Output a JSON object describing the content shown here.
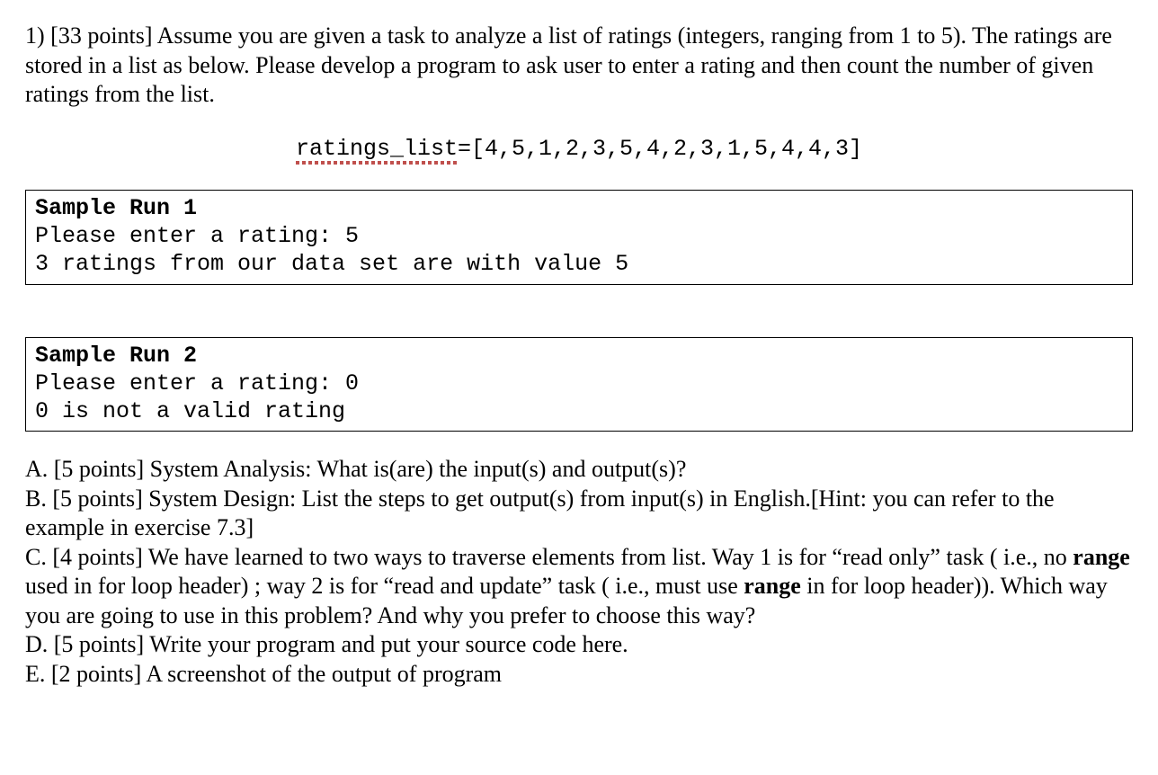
{
  "question": {
    "prefix": "1) [33 points]",
    "text_after_prefix": " Assume you are given a task to analyze a list of ratings (integers, ranging from 1 to 5). The ratings are stored in a list as below. Please develop a program to ask user to enter a rating and then count the number of given ratings from the list."
  },
  "code": {
    "var_name": "ratings_list",
    "rest": "=[4,5,1,2,3,5,4,2,3,1,5,4,4,3]"
  },
  "sample1": {
    "title": "Sample Run 1",
    "line1": "Please enter a rating: 5",
    "line2": "3 ratings from our data set are with value 5"
  },
  "sample2": {
    "title": "Sample Run 2",
    "line1": "Please enter a rating: 0",
    "line2": "0 is not a valid rating"
  },
  "parts": {
    "a_prefix": "A. [5 points]",
    "a_text": " System Analysis: What is(are) the input(s) and output(s)?",
    "b_prefix": "B. [5 points]",
    "b_text": " System Design: List the steps to get output(s) from input(s) in English.[Hint: you can refer to the example in exercise 7.3]",
    "c_prefix": "C. [4 points]",
    "c_seg1": " We have learned to two ways to traverse elements from list. Way 1 is for  “read only” task ( i.e., no ",
    "c_bold1": "range",
    "c_seg2": " used in for loop header) ; way 2 is for  “read and update” task ( i.e., must use ",
    "c_bold2": "range",
    "c_seg3": " in for loop header)).  Which way you are going to use in this problem? And why you prefer to choose this way?",
    "d_prefix": "D. [5 points]",
    "d_text": " Write your program and put your source code here.",
    "e_prefix": "E. [2 points]",
    "e_text": " A screenshot of the output of program"
  }
}
